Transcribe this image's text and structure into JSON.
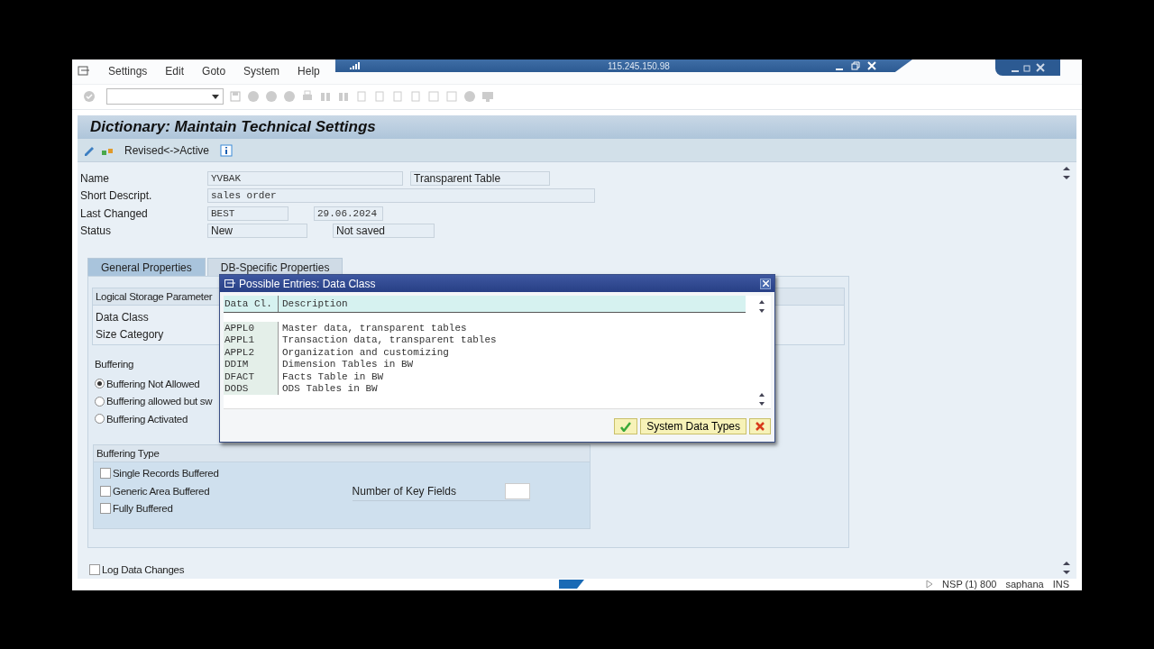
{
  "connection_bar": {
    "address": "115.245.150.98"
  },
  "menu": [
    {
      "label": "Settings"
    },
    {
      "label": "Edit"
    },
    {
      "label": "Goto"
    },
    {
      "label": "System"
    },
    {
      "label": "Help"
    }
  ],
  "title": "Dictionary: Maintain Technical Settings",
  "app_toolbar": {
    "button": "Revised<->Active"
  },
  "header_fields": [
    {
      "label": "Name",
      "values": [
        {
          "text": "YVBAK",
          "kind": "mono"
        },
        {
          "text": "Transparent Table",
          "kind": "plain"
        }
      ]
    },
    {
      "label": "Short Descript.",
      "values": [
        {
          "text": "sales order",
          "kind": "mono"
        }
      ]
    },
    {
      "label": "Last Changed",
      "values": [
        {
          "text": "BEST",
          "kind": "mono"
        },
        {
          "text": "29.06.2024",
          "kind": "mono"
        }
      ]
    },
    {
      "label": "Status",
      "values": [
        {
          "text": "New",
          "kind": "plain"
        },
        {
          "text": "Not saved",
          "kind": "plain"
        }
      ]
    }
  ],
  "tabs": [
    {
      "label": "General Properties",
      "selected": true
    },
    {
      "label": "DB-Specific Properties",
      "selected": false
    }
  ],
  "storage": {
    "title": "Logical Storage Parameter",
    "fields": [
      "Data Class",
      "Size Category"
    ]
  },
  "buffering": {
    "title": "Buffering",
    "options": [
      {
        "label": "Buffering Not Allowed",
        "selected": true
      },
      {
        "label": "Buffering allowed but sw",
        "selected": false
      },
      {
        "label": "Buffering Activated",
        "selected": false
      }
    ]
  },
  "buffering_type": {
    "title": "Buffering Type",
    "options": [
      {
        "label": "Single Records Buffered",
        "checked": false
      },
      {
        "label": "Generic Area Buffered",
        "checked": false
      },
      {
        "label": "Fully Buffered",
        "checked": false
      }
    ],
    "key_fields_label": "Number of Key Fields"
  },
  "log_changes": {
    "label": "Log Data Changes",
    "checked": false
  },
  "popup": {
    "title": "Possible Entries: Data Class",
    "columns": [
      "Data Cl.",
      "Description"
    ],
    "rows": [
      {
        "code": "APPL0",
        "description": "Master data, transparent tables"
      },
      {
        "code": "APPL1",
        "description": "Transaction data, transparent tables"
      },
      {
        "code": "APPL2",
        "description": "Organization and customizing"
      },
      {
        "code": "DDIM",
        "description": "Dimension Tables in BW"
      },
      {
        "code": "DFACT",
        "description": "Facts Table in BW"
      },
      {
        "code": "DODS",
        "description": "ODS Tables in BW"
      }
    ],
    "button": "System Data Types"
  },
  "status_bar": {
    "system": "NSP (1) 800",
    "server": "saphana",
    "mode": "INS"
  }
}
